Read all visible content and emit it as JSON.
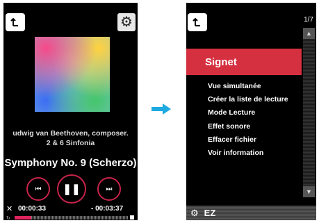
{
  "left_screen": {
    "back_icon": "return-arrow-icon",
    "settings_icon": "gear-icon",
    "artist": "udwig van Beethoven, composer.",
    "album": "2 & 6 Sinfonia",
    "track": "Symphony No. 9 (Scherzo)",
    "controls": {
      "prev_icon": "skip-previous-icon",
      "play_icon": "pause-icon",
      "next_icon": "skip-next-icon"
    },
    "shuffle_icon": "shuffle-icon",
    "repeat_icon": "repeat-icon",
    "elapsed": "00:00:33",
    "remaining": "- 00:03:37",
    "progress": 0.15,
    "progress_color": "#e0245e"
  },
  "arrow": {
    "icon": "right-arrow-icon",
    "color": "#1fa9e1"
  },
  "right_screen": {
    "back_icon": "return-arrow-icon",
    "page_indicator": "1/7",
    "highlighted_item": "Signet",
    "menu_items": [
      "Vue simultanée",
      "Créer la liste de lecture",
      "Mode Lecture",
      "Effet sonore",
      "Effacer fichier",
      "Voir information"
    ],
    "scroll_up_icon": "chevron-up-icon",
    "scroll_down_icon": "chevron-down-icon",
    "bottom_bar": {
      "icon": "gear-icon",
      "label": "EZ"
    },
    "highlight_color": "#d5303f"
  }
}
